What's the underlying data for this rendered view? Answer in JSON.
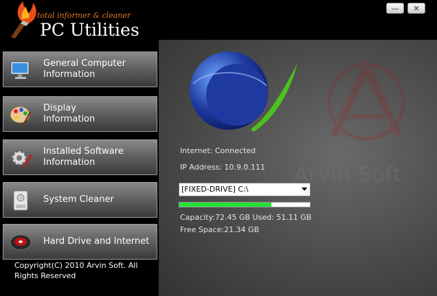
{
  "app": {
    "tagline": "total informer & cleaner",
    "title": "PC Utilities",
    "minimize_icon": "minimize-icon",
    "close_icon": "close-icon"
  },
  "sidebar": {
    "items": [
      {
        "line1": "General Computer",
        "line2": "Information",
        "icon": "monitor-icon"
      },
      {
        "line1": "Display",
        "line2": "Information",
        "icon": "palette-icon"
      },
      {
        "line1": "Installed Software",
        "line2": "Information",
        "icon": "gear-icon"
      },
      {
        "line1": "System Cleaner",
        "line2": "",
        "icon": "drive-icon"
      },
      {
        "line1": "Hard Drive and Internet",
        "line2": "",
        "icon": "disk-icon"
      }
    ],
    "copyright": "Copyright(C) 2010 Arvin Soft. All Rights Reserved"
  },
  "main": {
    "internet_status": "Internet: Connected",
    "ip_address": "IP Address: 10.9.0.111",
    "drive_selected": "[FIXED-DRIVE] C:\\",
    "usage_fraction": 0.705,
    "capacity_line": "Capacity:72.45 GB  Used: 51.11 GB",
    "free_space": "Free Space:21.34 GB",
    "watermark_text": "Arvin Soft"
  },
  "colors": {
    "usage_bar": "#22e034",
    "globe": "#1e3aa0",
    "swoosh": "#4cc21e",
    "logo_accent": "#e0782a"
  }
}
